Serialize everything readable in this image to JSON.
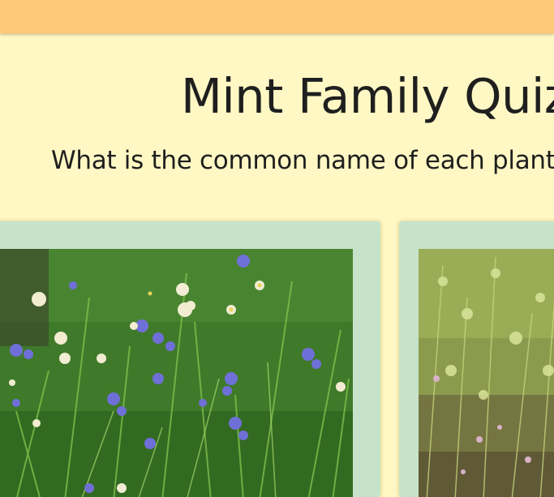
{
  "page": {
    "title": "Mint Family Quiz",
    "subtitle": "What is the common name of each plant"
  },
  "colors": {
    "topbar": "#ffc97a",
    "background": "#fff8c4",
    "card": "#c6e3c9",
    "text": "#1f1f1f"
  }
}
